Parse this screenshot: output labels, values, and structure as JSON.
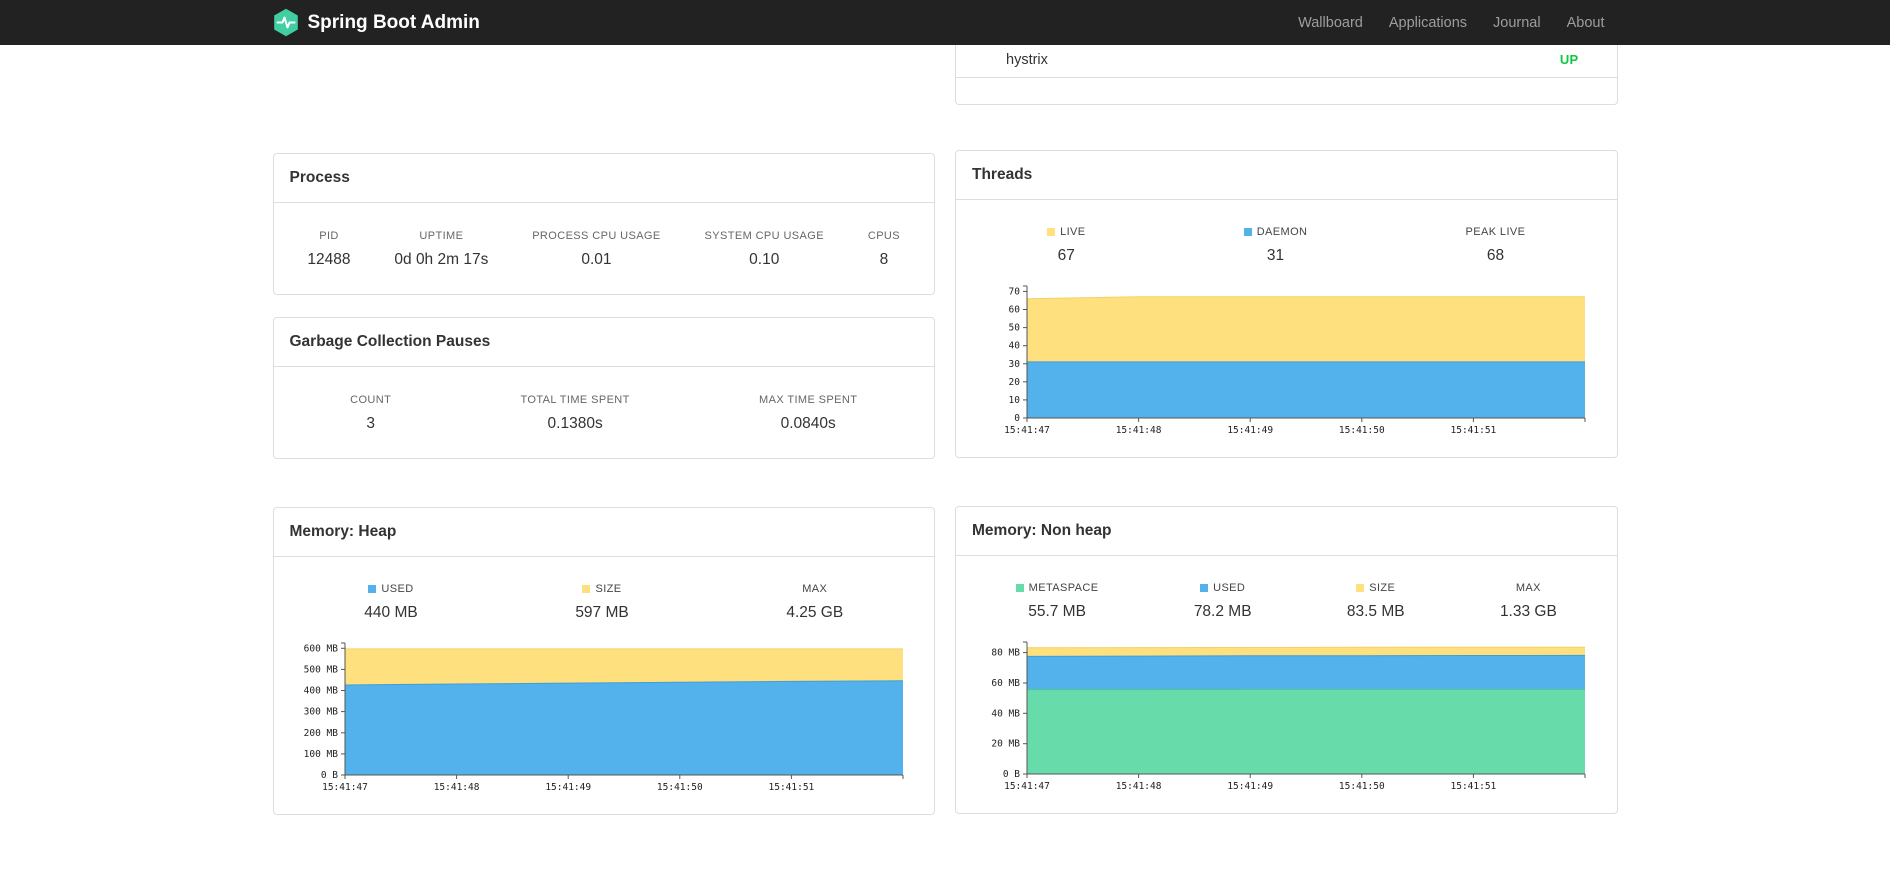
{
  "navbar": {
    "brand": "Spring Boot Admin",
    "logo_color": "#41CEA2",
    "items": [
      {
        "label": "Wallboard"
      },
      {
        "label": "Applications"
      },
      {
        "label": "Journal"
      },
      {
        "label": "About"
      }
    ]
  },
  "health": {
    "rows": [
      {
        "name": "hystrix",
        "status": "UP"
      }
    ],
    "status_color": "#10C742"
  },
  "panels": {
    "process": {
      "title": "Process",
      "metrics": [
        {
          "label": "PID",
          "value": "12488"
        },
        {
          "label": "UPTIME",
          "value": "0d 0h 2m 17s"
        },
        {
          "label": "PROCESS CPU USAGE",
          "value": "0.01"
        },
        {
          "label": "SYSTEM CPU USAGE",
          "value": "0.10"
        },
        {
          "label": "CPUS",
          "value": "8"
        }
      ]
    },
    "gc": {
      "title": "Garbage Collection Pauses",
      "metrics": [
        {
          "label": "COUNT",
          "value": "3"
        },
        {
          "label": "TOTAL TIME SPENT",
          "value": "0.1380s"
        },
        {
          "label": "MAX TIME SPENT",
          "value": "0.0840s"
        }
      ]
    },
    "threads": {
      "title": "Threads",
      "legend": [
        {
          "label": "LIVE",
          "value": "67",
          "color": "#FFE07E"
        },
        {
          "label": "DAEMON",
          "value": "31",
          "color": "#53B1EB"
        },
        {
          "label": "PEAK LIVE",
          "value": "68"
        }
      ]
    },
    "heap": {
      "title": "Memory: Heap",
      "legend": [
        {
          "label": "USED",
          "value": "440 MB",
          "color": "#53B1EB"
        },
        {
          "label": "SIZE",
          "value": "597 MB",
          "color": "#FFE07E"
        },
        {
          "label": "MAX",
          "value": "4.25 GB"
        }
      ]
    },
    "nonheap": {
      "title": "Memory: Non heap",
      "legend": [
        {
          "label": "METASPACE",
          "value": "55.7 MB",
          "color": "#68DBAA"
        },
        {
          "label": "USED",
          "value": "78.2 MB",
          "color": "#53B1EB"
        },
        {
          "label": "SIZE",
          "value": "83.5 MB",
          "color": "#FFE07E"
        },
        {
          "label": "MAX",
          "value": "1.33 GB"
        }
      ]
    }
  },
  "chart_data": [
    {
      "id": "threads",
      "type": "area",
      "title": "Threads",
      "x": [
        "15:41:47",
        "15:41:48",
        "15:41:49",
        "15:41:50",
        "15:41:51"
      ],
      "ylim": [
        0,
        73
      ],
      "yticks": [
        {
          "v": 0,
          "label": "0"
        },
        {
          "v": 10,
          "label": "10"
        },
        {
          "v": 20,
          "label": "20"
        },
        {
          "v": 30,
          "label": "30"
        },
        {
          "v": 40,
          "label": "40"
        },
        {
          "v": 50,
          "label": "50"
        },
        {
          "v": 60,
          "label": "60"
        },
        {
          "v": 70,
          "label": "70"
        }
      ],
      "series": [
        {
          "name": "LIVE",
          "color": "#FFE07E",
          "stroke": "#F2D266",
          "values": [
            66,
            67,
            67,
            67,
            67,
            67
          ]
        },
        {
          "name": "DAEMON",
          "color": "#53B1EB",
          "stroke": "#3E9FD8",
          "values": [
            31,
            31,
            31,
            31,
            31,
            31
          ]
        }
      ]
    },
    {
      "id": "heap",
      "type": "area",
      "title": "Memory: Heap",
      "x": [
        "15:41:47",
        "15:41:48",
        "15:41:49",
        "15:41:50",
        "15:41:51"
      ],
      "ylim": [
        0,
        625
      ],
      "yticks": [
        {
          "v": 0,
          "label": "0 B"
        },
        {
          "v": 100,
          "label": "100 MB"
        },
        {
          "v": 200,
          "label": "200 MB"
        },
        {
          "v": 300,
          "label": "300 MB"
        },
        {
          "v": 400,
          "label": "400 MB"
        },
        {
          "v": 500,
          "label": "500 MB"
        },
        {
          "v": 600,
          "label": "600 MB"
        }
      ],
      "series": [
        {
          "name": "SIZE",
          "color": "#FFE07E",
          "stroke": "#F2D266",
          "values": [
            597,
            597,
            597,
            597,
            597,
            597
          ]
        },
        {
          "name": "USED",
          "color": "#53B1EB",
          "stroke": "#3E9FD8",
          "values": [
            426,
            431,
            435,
            439,
            443,
            446
          ]
        }
      ]
    },
    {
      "id": "nonheap",
      "type": "area",
      "title": "Memory: Non heap",
      "x": [
        "15:41:47",
        "15:41:48",
        "15:41:49",
        "15:41:50",
        "15:41:51"
      ],
      "ylim": [
        0,
        87
      ],
      "yticks": [
        {
          "v": 0,
          "label": "0 B"
        },
        {
          "v": 20,
          "label": "20 MB"
        },
        {
          "v": 40,
          "label": "40 MB"
        },
        {
          "v": 60,
          "label": "60 MB"
        },
        {
          "v": 80,
          "label": "80 MB"
        }
      ],
      "series": [
        {
          "name": "SIZE",
          "color": "#FFE07E",
          "stroke": "#F2D266",
          "values": [
            83.2,
            83.3,
            83.4,
            83.5,
            83.5,
            83.5
          ]
        },
        {
          "name": "USED",
          "color": "#53B1EB",
          "stroke": "#3E9FD8",
          "values": [
            77.5,
            77.7,
            77.9,
            78.0,
            78.1,
            78.2
          ]
        },
        {
          "name": "METASPACE",
          "color": "#68DBAA",
          "stroke": "#4FC796",
          "values": [
            55.6,
            55.6,
            55.7,
            55.7,
            55.7,
            55.7
          ]
        }
      ]
    }
  ]
}
